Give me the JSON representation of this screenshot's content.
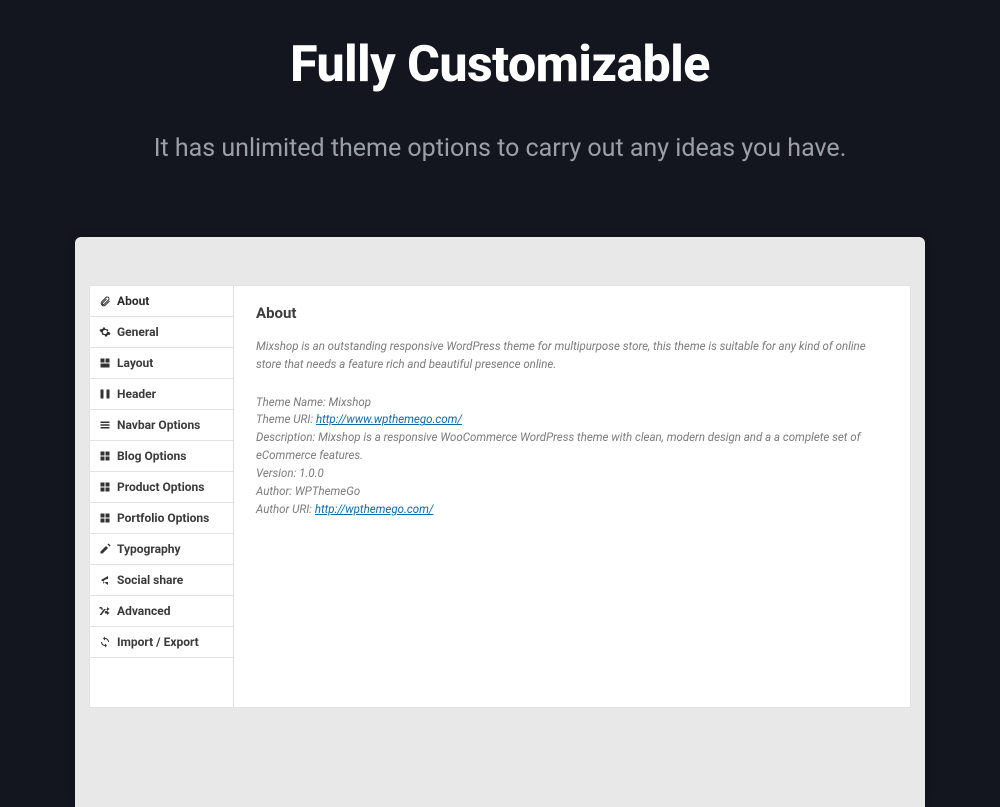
{
  "hero": {
    "title": "Fully Customizable",
    "subtitle": "It has unlimited theme options to carry out any ideas you have."
  },
  "sidebar": {
    "items": [
      {
        "label": "About",
        "icon": "attachment-icon"
      },
      {
        "label": "General",
        "icon": "gear-icon"
      },
      {
        "label": "Layout",
        "icon": "layout-icon"
      },
      {
        "label": "Header",
        "icon": "header-icon"
      },
      {
        "label": "Navbar Options",
        "icon": "menu-icon"
      },
      {
        "label": "Blog Options",
        "icon": "blog-icon"
      },
      {
        "label": "Product Options",
        "icon": "product-icon"
      },
      {
        "label": "Portfolio Options",
        "icon": "portfolio-icon"
      },
      {
        "label": "Typography",
        "icon": "edit-icon"
      },
      {
        "label": "Social share",
        "icon": "share-icon"
      },
      {
        "label": "Advanced",
        "icon": "shuffle-icon"
      },
      {
        "label": "Import / Export",
        "icon": "refresh-icon"
      }
    ]
  },
  "content": {
    "title": "About",
    "description": "Mixshop is an outstanding responsive WordPress theme for multipurpose store, this theme is suitable for any kind of online store that needs a feature rich and beautiful presence online.",
    "theme_name_label": "Theme Name:",
    "theme_name": "Mixshop",
    "theme_uri_label": "Theme URI:",
    "theme_uri": "http://www.wpthemego.com/",
    "description_label": "Description:",
    "description_value": "Mixshop is a responsive WooCommerce WordPress theme with clean, modern design and a a complete set of eCommerce features.",
    "version_label": "Version:",
    "version": "1.0.0",
    "author_label": "Author:",
    "author": "WPThemeGo",
    "author_uri_label": "Author URI:",
    "author_uri": "http://wpthemego.com/"
  }
}
